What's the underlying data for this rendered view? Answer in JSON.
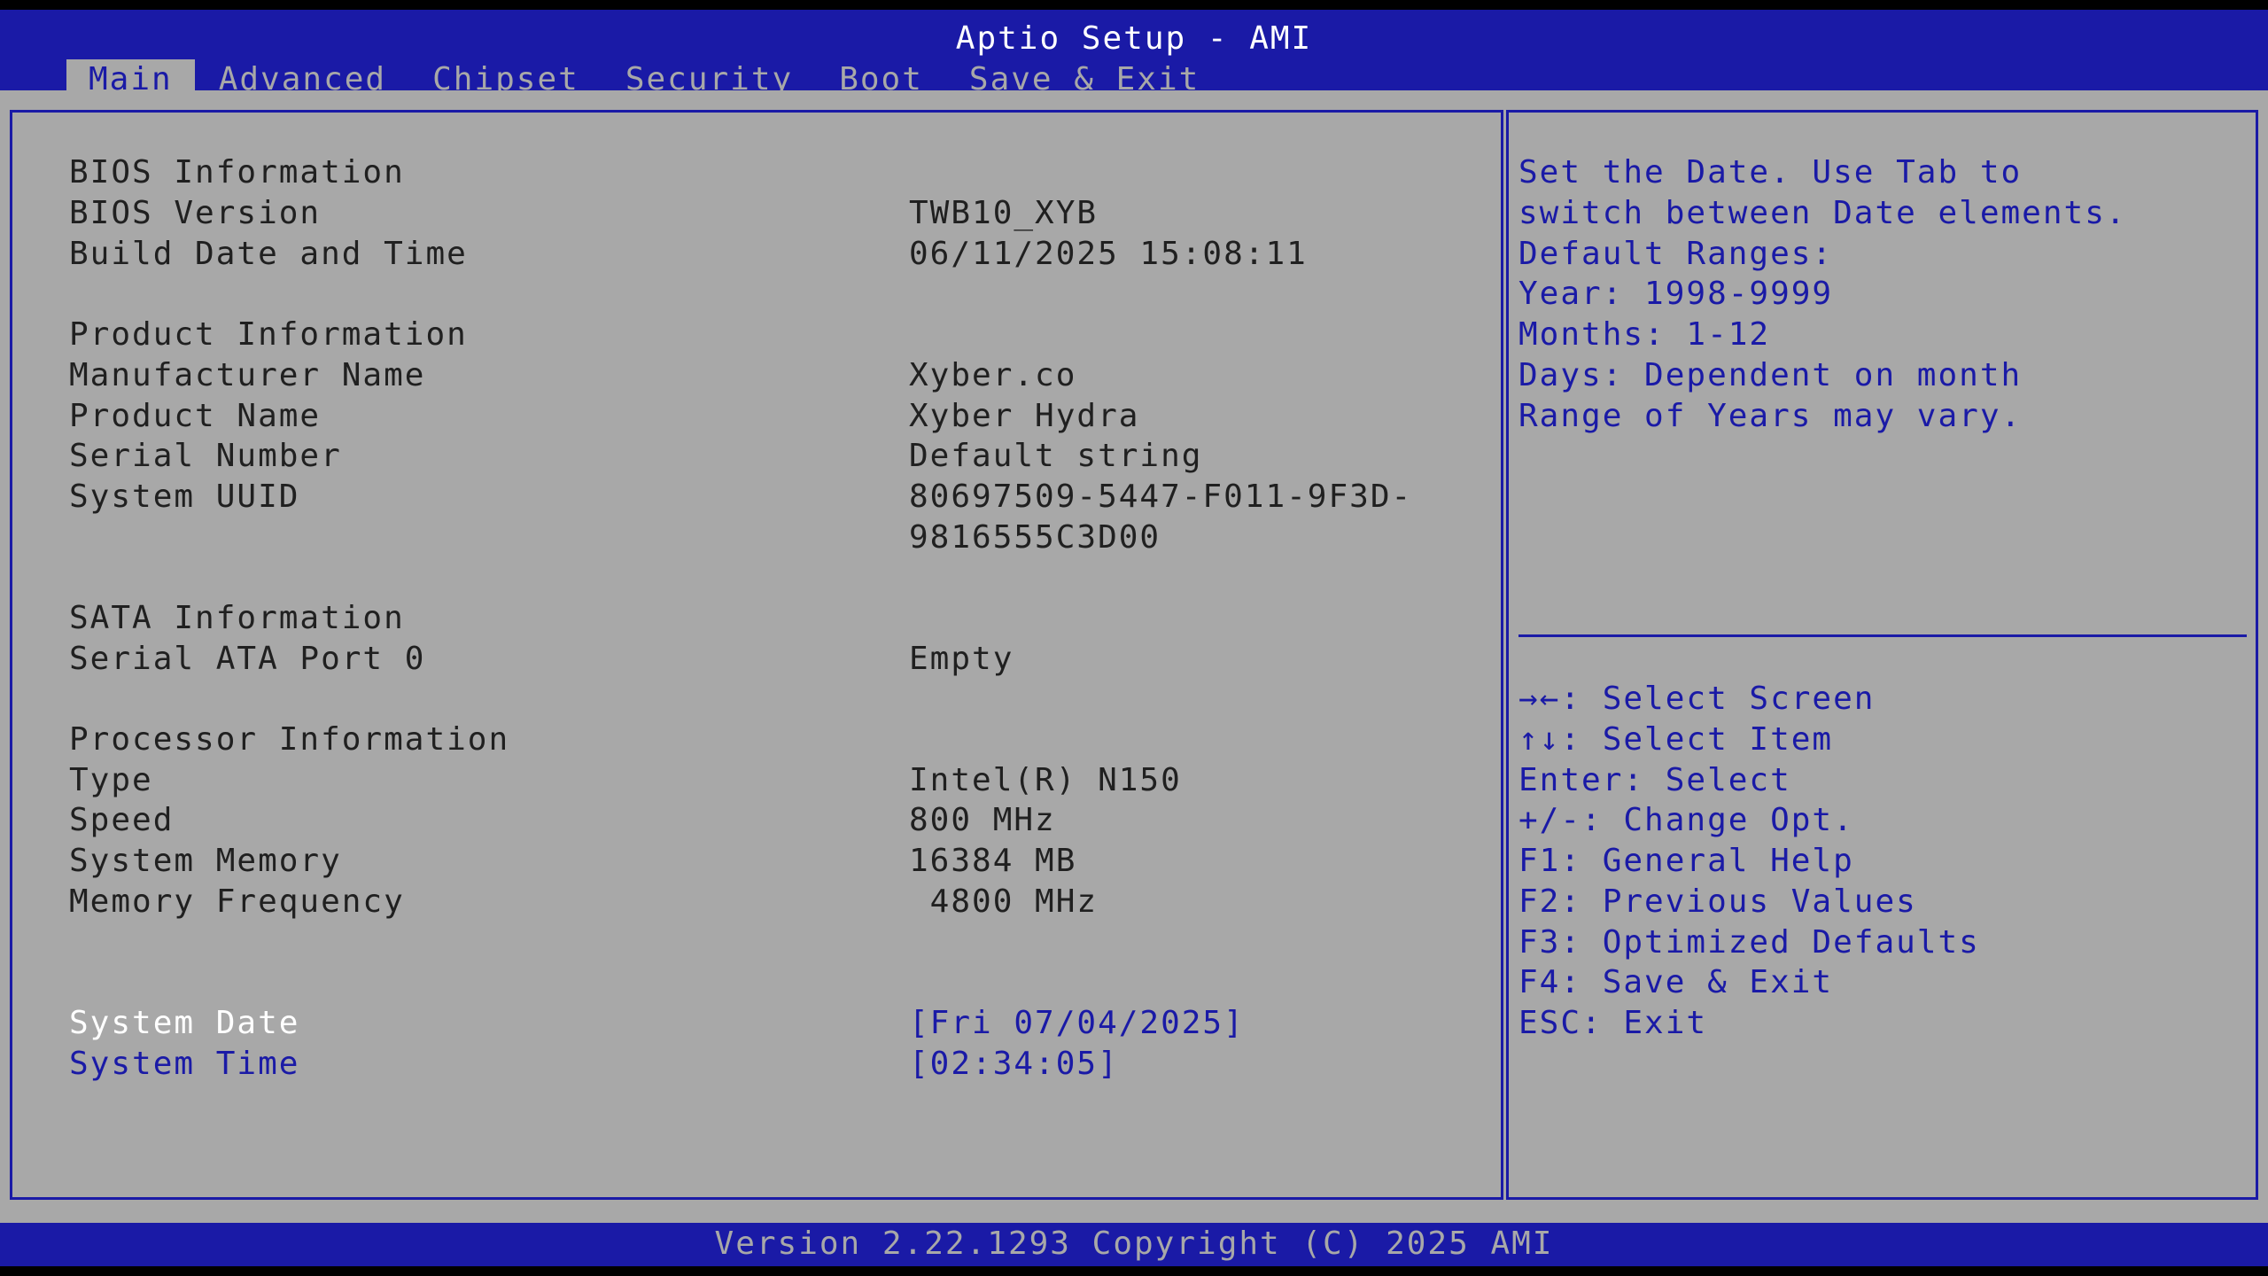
{
  "header": {
    "title": "Aptio Setup - AMI",
    "tabs": [
      {
        "label": "Main",
        "active": true
      },
      {
        "label": "Advanced"
      },
      {
        "label": "Chipset"
      },
      {
        "label": "Security"
      },
      {
        "label": "Boot"
      },
      {
        "label": "Save & Exit"
      }
    ]
  },
  "main": {
    "bios_info": {
      "heading": "BIOS Information",
      "bios_version_label": "BIOS Version",
      "bios_version": "TWB10_XYB",
      "build_date_label": "Build Date and Time",
      "build_date": "06/11/2025 15:08:11"
    },
    "product_info": {
      "heading": "Product Information",
      "manufacturer_label": "Manufacturer Name",
      "manufacturer": "Xyber.co",
      "product_name_label": "Product Name",
      "product_name": "Xyber Hydra",
      "serial_label": "Serial Number",
      "serial": "Default string",
      "uuid_label": "System UUID",
      "uuid_line1": "80697509-5447-F011-9F3D-",
      "uuid_line2": "9816555C3D00"
    },
    "sata_info": {
      "heading": "SATA Information",
      "port0_label": "Serial ATA Port 0",
      "port0": "Empty"
    },
    "processor_info": {
      "heading": "Processor Information",
      "type_label": "Type",
      "type": "Intel(R) N150",
      "speed_label": "Speed",
      "speed": "800 MHz",
      "memory_label": "System Memory",
      "memory": "16384 MB",
      "mem_freq_label": "Memory Frequency",
      "mem_freq": " 4800 MHz"
    },
    "system_date_label": "System Date",
    "system_date": "[Fri 07/04/2025]",
    "system_time_label": "System Time",
    "system_time": "[02:34:05]"
  },
  "help": {
    "description": [
      "Set the Date. Use Tab to",
      "switch between Date elements.",
      "Default Ranges:",
      "Year: 1998-9999",
      "Months: 1-12",
      "Days: Dependent on month",
      "Range of Years may vary."
    ],
    "keys": [
      "→←: Select Screen",
      "↑↓: Select Item",
      "Enter: Select",
      "+/-: Change Opt.",
      "F1: General Help",
      "F2: Previous Values",
      "F3: Optimized Defaults",
      "F4: Save & Exit",
      "ESC: Exit"
    ]
  },
  "footer": {
    "text": "Version 2.22.1293 Copyright (C) 2025 AMI"
  },
  "colors": {
    "bios_blue": "#1a1aa6",
    "bios_gray": "#a8a8a8",
    "text_dark": "#202020",
    "highlight_white": "#ffffff"
  }
}
